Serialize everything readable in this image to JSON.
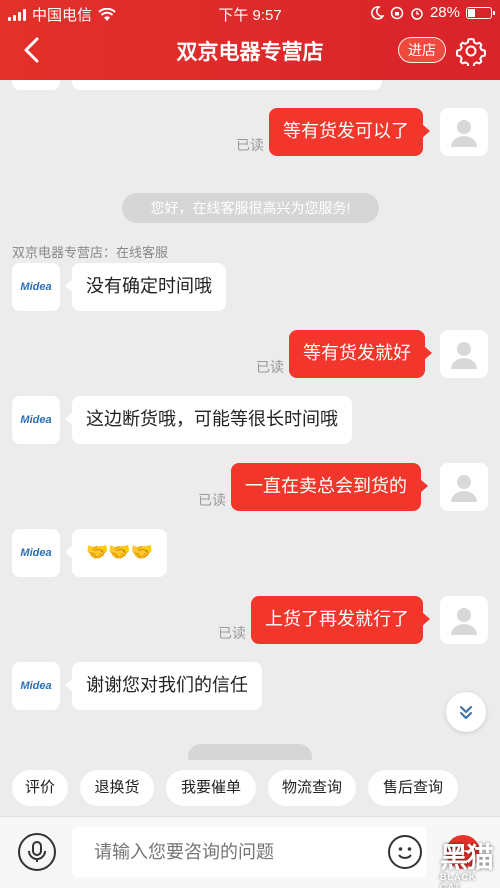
{
  "status_bar": {
    "carrier": "中国电信",
    "time": "下午 9:57",
    "battery": "28%",
    "battery_level": 0.28
  },
  "header": {
    "title": "双京电器专营店",
    "shop_button": "进店"
  },
  "chat": {
    "read_label": "已读",
    "messages": [
      {
        "from": "me",
        "text": "等有货发可以了"
      },
      {
        "from": "system",
        "text": "您好，在线客服很高兴为您服务!"
      },
      {
        "from": "sender_label",
        "text": "双京电器专营店：在线客服"
      },
      {
        "from": "shop",
        "text": "没有确定时间哦"
      },
      {
        "from": "me",
        "text": "等有货发就好"
      },
      {
        "from": "shop",
        "text": "这边断货哦，可能等很长时间哦"
      },
      {
        "from": "me",
        "text": "一直在卖总会到货的"
      },
      {
        "from": "shop",
        "text": "🤝🤝🤝"
      },
      {
        "from": "me",
        "text": "上货了再发就行了"
      },
      {
        "from": "shop",
        "text": "谢谢您对我们的信任"
      }
    ],
    "shop_avatar_logo": "Midea"
  },
  "quick_replies": [
    "评价",
    "退换货",
    "我要催单",
    "物流查询",
    "售后查询"
  ],
  "input": {
    "placeholder": "请输入您要咨询的问题"
  },
  "watermark": {
    "text_zh": "黑猫",
    "text_en": "BLACK CAT"
  },
  "colors": {
    "header_red": "#e4302a",
    "bubble_red": "#f2362b",
    "background": "#ececec"
  }
}
